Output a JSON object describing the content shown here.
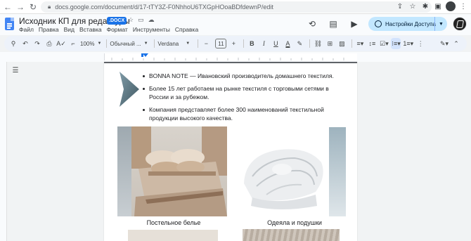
{
  "browser": {
    "url": "docs.google.com/document/d/17-tTY3Z-F0NhhoU6TXGpHOoaBDfdewnP/edit"
  },
  "doc": {
    "title": "Исходник КП для редактуры",
    "badge": ".DOCX",
    "menu": [
      "Файл",
      "Правка",
      "Вид",
      "Вставка",
      "Формат",
      "Инструменты",
      "Справка"
    ],
    "share_label": "Настройки Доступа"
  },
  "toolbar": {
    "zoom": "100%",
    "style": "Обычный ...",
    "font": "Verdana",
    "font_size": "11"
  },
  "content": {
    "bullets": [
      "BONNA NOTE — Ивановский производитель домашнего текстиля.",
      "Более 15 лет работаем на рынке текстиля с торговыми сетями в России и за рубежом.",
      "Компания представляет более 300 наименований текстильной продукции высокого качества."
    ],
    "captions": [
      "Постельное белье",
      "Одеяла и подушки"
    ]
  },
  "colors": {
    "accent": "#1a73e8",
    "share_bg": "#c2e7ff",
    "toolbar_bg": "#edf2fa"
  }
}
